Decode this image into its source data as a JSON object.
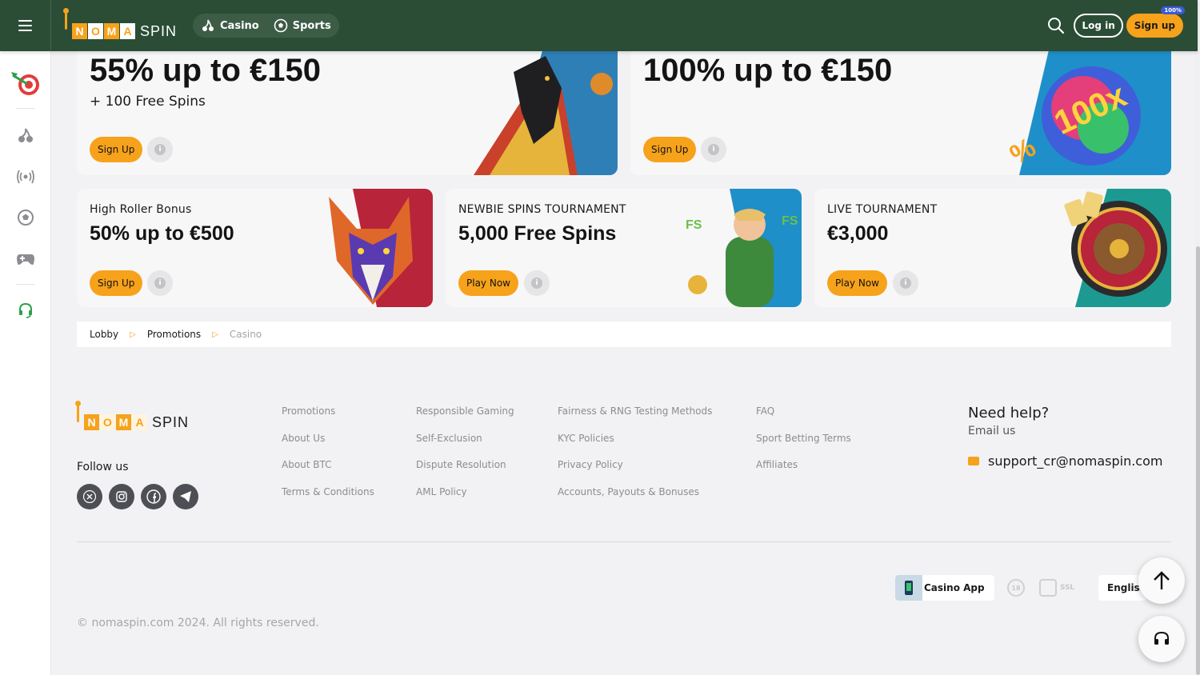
{
  "header": {
    "logo": {
      "letters": [
        "N",
        "O",
        "M",
        "A"
      ],
      "word": "SPIN"
    },
    "nav": [
      {
        "label": "Casino",
        "icon": "cherry-icon"
      },
      {
        "label": "Sports",
        "icon": "soccer-ball-icon"
      }
    ],
    "login_label": "Log in",
    "signup_label": "Sign up",
    "signup_badge": "100%"
  },
  "sidebar": {
    "items": [
      {
        "icon": "target-darts-icon"
      },
      {
        "icon": "cherry-icon"
      },
      {
        "icon": "live-broadcast-icon"
      },
      {
        "icon": "soccer-ball-icon"
      },
      {
        "icon": "gamepad-icon"
      },
      {
        "icon": "headset-icon"
      }
    ]
  },
  "promos": {
    "top": [
      {
        "title": "55% up to €150",
        "subtitle": "+ 100 Free Spins",
        "cta": "Sign Up",
        "info": "i"
      },
      {
        "title": "100% up to €150",
        "subtitle": "",
        "cta": "Sign Up",
        "info": "i"
      }
    ],
    "cards": [
      {
        "label": "High Roller Bonus",
        "title": "50% up to €500",
        "cta": "Sign Up",
        "info": "i"
      },
      {
        "label": "NEWBIE SPINS TOURNAMENT",
        "title": "5,000 Free Spins",
        "cta": "Play Now",
        "info": "i"
      },
      {
        "label": "LIVE TOURNAMENT",
        "title": "€3,000",
        "cta": "Play Now",
        "info": "i"
      }
    ]
  },
  "breadcrumb": {
    "items": [
      "Lobby",
      "Promotions",
      "Casino"
    ],
    "separator": "▷"
  },
  "footer": {
    "follow_label": "Follow us",
    "socials": [
      "x-icon",
      "instagram-icon",
      "facebook-icon",
      "telegram-icon"
    ],
    "columns": [
      [
        "Promotions",
        "About Us",
        "About BTC",
        "Terms & Conditions"
      ],
      [
        "Responsible Gaming",
        "Self-Exclusion",
        "Dispute Resolution",
        "AML Policy"
      ],
      [
        "Fairness & RNG Testing Methods",
        "KYC Policies",
        "Privacy Policy",
        "Accounts, Payouts & Bonuses"
      ],
      [
        "FAQ",
        "Sport Betting Terms",
        "Affiliates"
      ]
    ],
    "help": {
      "title": "Need help?",
      "subtitle": "Email us",
      "email": "support_cr@nomaspin.com"
    },
    "app_label": "Casino App",
    "age_badge": "18",
    "ssl_label": "SSL",
    "language": "English",
    "copyright": "© nomaspin.com 2024. All rights reserved."
  },
  "colors": {
    "header_bg": "#2b4d36",
    "accent": "#f7a21b",
    "page_bg": "#f2f2f4"
  }
}
